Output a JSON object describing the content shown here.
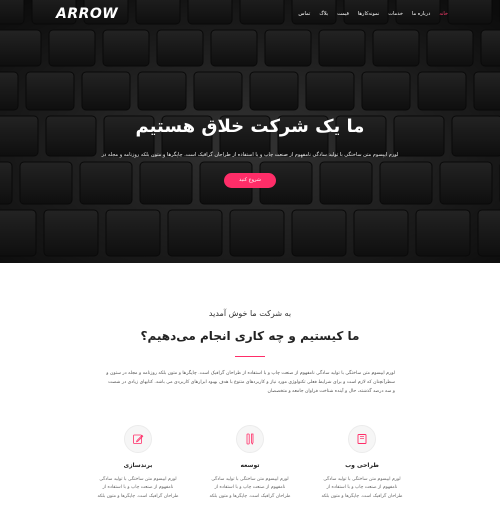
{
  "brand": {
    "logo": "ARROW"
  },
  "nav": {
    "items": [
      {
        "label": "خانه",
        "active": true
      },
      {
        "label": "درباره ما"
      },
      {
        "label": "خدمات"
      },
      {
        "label": "نمونه‌کارها"
      },
      {
        "label": "قیمت"
      },
      {
        "label": "بلاگ"
      },
      {
        "label": "تماس"
      }
    ]
  },
  "hero": {
    "title": "ما یک شرکت خلاق هستیم",
    "subtitle": "لورم ایپسوم متن ساختگی با تولید سادگی نامفهوم از صنعت چاپ و با استفاده از طراحان گرافیک است. چاپگرها و متون بلکه روزنامه و مجله در",
    "button": "شروع کنید"
  },
  "about": {
    "welcome": "به شرکت ما خوش آمدید",
    "title": "ما کیستیم و چه کاری انجام می‌دهیم؟",
    "text": "لورم ایپسوم متن ساختگی با تولید سادگی نامفهوم از صنعت چاپ و با استفاده از طراحان گرافیک است. چاپگرها و متون بلکه روزنامه و مجله در ستون و سطرآنچنان که لازم است و برای شرایط فعلی تکنولوژی مورد نیاز و کاربردهای متنوع با هدف بهبود ابزارهای کاربردی می باشد. کتابهای زیادی در شصت و سه درصد گذشته، حال و آینده شناخت فراوان جامعه و متخصصان"
  },
  "services": [
    {
      "icon": "book-icon",
      "title": "طراحی وب",
      "text": "لورم ایپسوم متن ساختگی با تولید سادگی نامفهوم از صنعت چاپ و با استفاده از طراحان گرافیک است. چاپگرها و متون بلکه"
    },
    {
      "icon": "pencil-ruler-icon",
      "title": "توسعه",
      "text": "لورم ایپسوم متن ساختگی با تولید سادگی نامفهوم از صنعت چاپ و با استفاده از طراحان گرافیک است. چاپگرها و متون بلکه"
    },
    {
      "icon": "edit-icon",
      "title": "برندسازی",
      "text": "لورم ایپسوم متن ساختگی با تولید سادگی نامفهوم از صنعت چاپ و با استفاده از طراحان گرافیک است. چاپگرها و متون بلکه"
    }
  ],
  "colors": {
    "accent": "#ff2d68",
    "hero_overlay": "#000000",
    "text_dark": "#222222"
  }
}
